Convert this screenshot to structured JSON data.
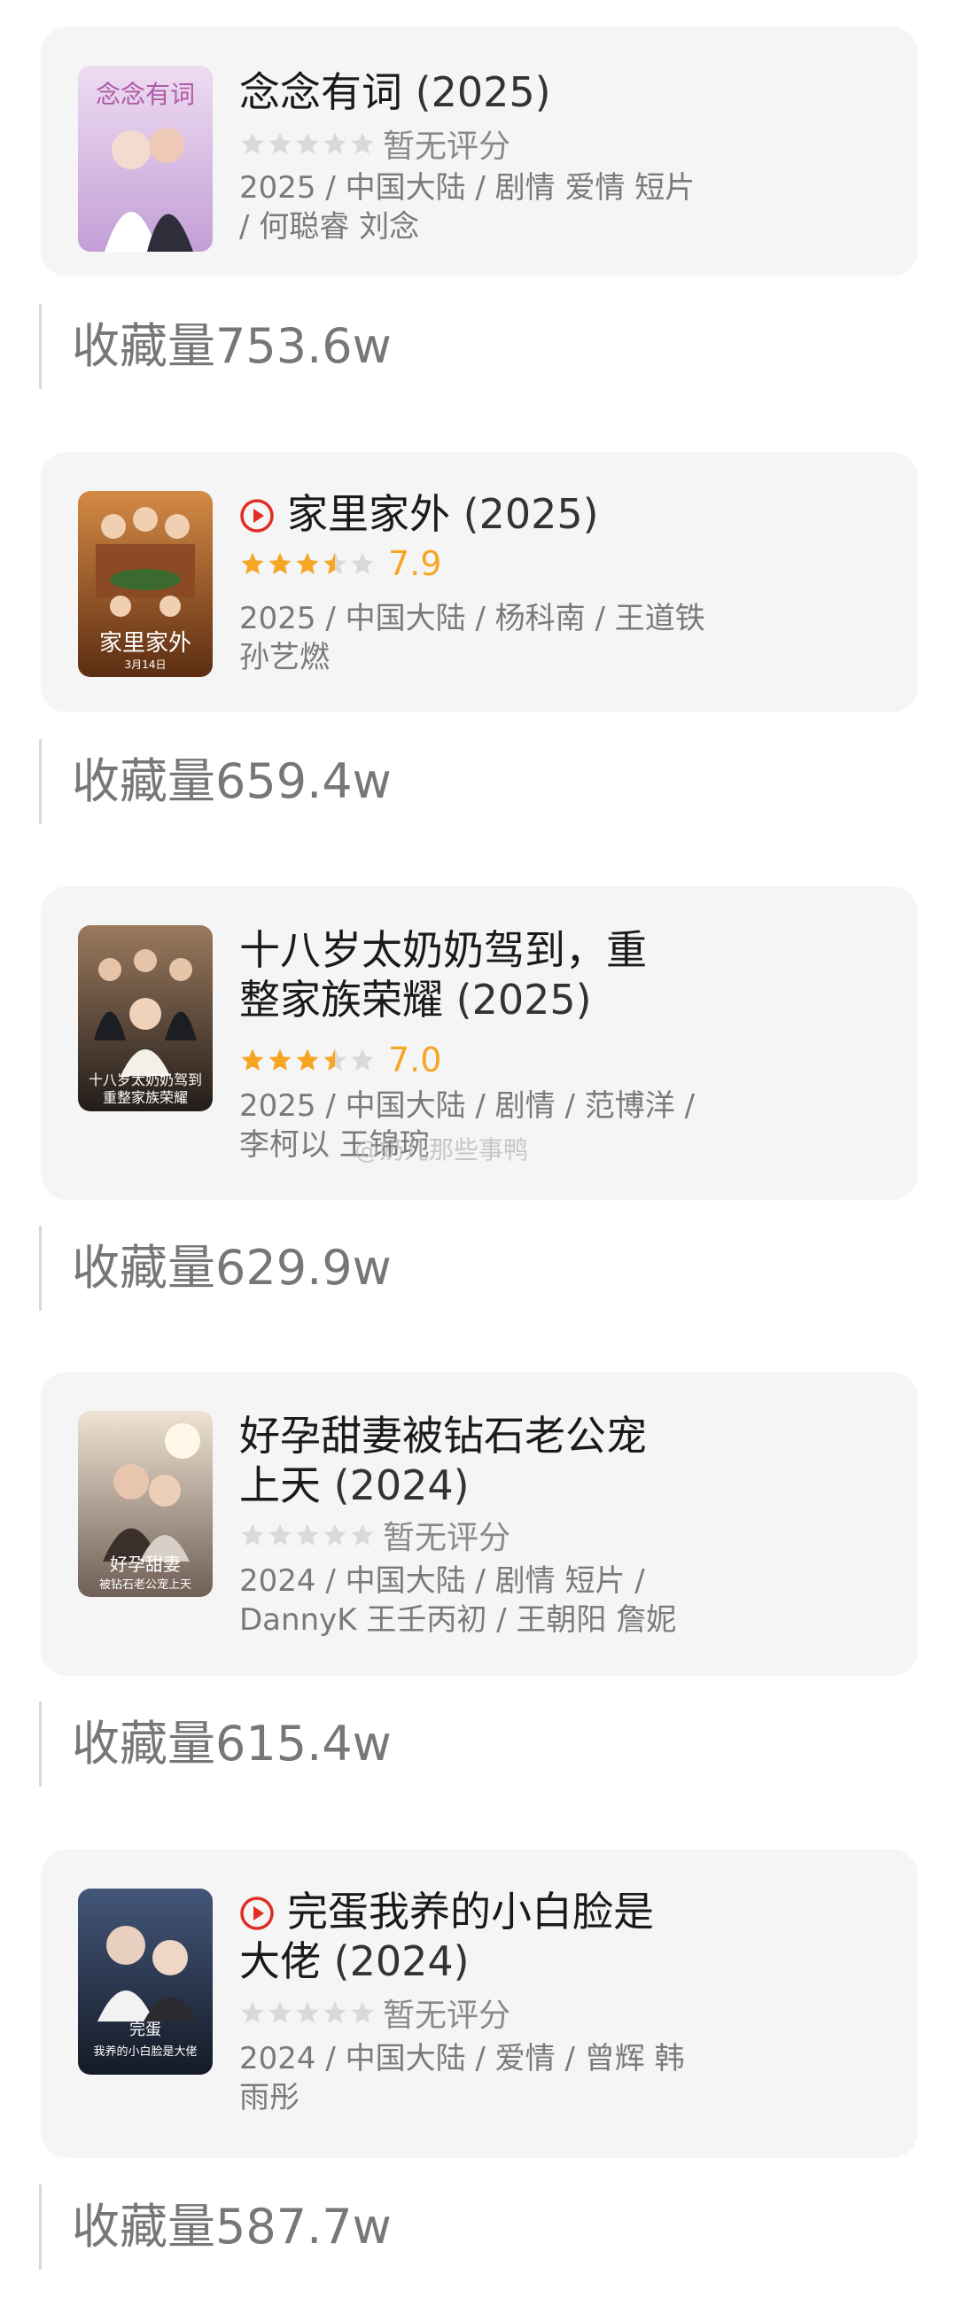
{
  "items": [
    {
      "title": "念念有词",
      "year": "(2025)",
      "has_play": false,
      "rating_stars": 0,
      "rating_text": "暂无评分",
      "meta_line1": "2025 / 中国大陆 / 剧情 爱情 短片",
      "meta_line2": "/ 何聪睿 刘念",
      "favorites": "收藏量753.6w",
      "poster_text": "念念有词",
      "poster_colors": [
        "#e8d6ef",
        "#c9a8d8"
      ]
    },
    {
      "title": "家里家外",
      "year": "(2025)",
      "has_play": true,
      "rating_stars": 3.5,
      "rating_text": "7.9",
      "meta_line1": "2025 / 中国大陆 / 杨科南 / 王道铁",
      "meta_line2": "孙艺燃",
      "favorites": "收藏量659.4w",
      "poster_text": "家里家外",
      "poster_sub": "3月14日",
      "poster_colors": [
        "#c7732e",
        "#6b3616"
      ]
    },
    {
      "title": "十八岁太奶奶驾到，重整家族荣耀",
      "title_line1": "十八岁太奶奶驾到，重",
      "title_line2": "整家族荣耀",
      "year": "(2025)",
      "has_play": false,
      "rating_stars": 3.5,
      "rating_text": "7.0",
      "meta_line1": "2025 / 中国大陆 / 剧情 / 范博洋 /",
      "meta_line2": "李柯以 王锦琬",
      "favorites": "收藏量629.9w",
      "poster_text": "十八岁太奶奶驾到",
      "poster_sub": "重整家族荣耀",
      "poster_colors": [
        "#8a6b52",
        "#2b2320"
      ]
    },
    {
      "title": "好孕甜妻被钻石老公宠上天",
      "title_line1": "好孕甜妻被钻石老公宠",
      "title_line2": "上天",
      "year": "(2024)",
      "has_play": false,
      "rating_stars": 0,
      "rating_text": "暂无评分",
      "meta_line1": "2024 / 中国大陆 / 剧情 短片 /",
      "meta_line2": "DannyK 王壬丙初 / 王朝阳 詹妮",
      "favorites": "收藏量615.4w",
      "poster_text": "好孕甜妻",
      "poster_sub": "被钻石老公宠上天",
      "poster_colors": [
        "#e9d9c6",
        "#7d6a5d"
      ]
    },
    {
      "title": "完蛋我养的小白脸是大佬",
      "title_line1": "完蛋我养的小白脸是",
      "title_line2": "大佬",
      "year": "(2024)",
      "has_play": true,
      "rating_stars": 0,
      "rating_text": "暂无评分",
      "meta_line1": "2024 / 中国大陆 / 爱情 / 曾辉 韩",
      "meta_line2": "雨彤",
      "favorites": "收藏量587.7w",
      "poster_text": "完蛋",
      "poster_sub": "我养的小白脸是大佬",
      "poster_colors": [
        "#3a4a63",
        "#161d2b"
      ]
    }
  ],
  "watermark": "@奶儿那些事鸭",
  "colors": {
    "card_bg": "#f5f5f5",
    "star_active": "#f5a623",
    "star_inactive": "#d9d9d9",
    "play_red": "#e02e24"
  },
  "icons": {
    "play": "play-circle-icon",
    "star": "star-icon"
  }
}
